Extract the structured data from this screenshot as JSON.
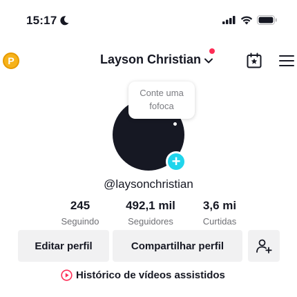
{
  "status_bar": {
    "time": "15:17",
    "icons": [
      "moon-icon",
      "signal-icon",
      "wifi-icon",
      "battery-icon"
    ]
  },
  "topbar": {
    "coin_label": "P",
    "username": "Layson Christian",
    "icons": [
      "chevron-down-icon",
      "calendar-star-icon",
      "menu-icon"
    ],
    "notification_color": "#fe2c55"
  },
  "profile": {
    "bubble_line1": "Conte uma",
    "bubble_line2": "fofoca",
    "add_symbol": "+",
    "handle": "@laysonchristian",
    "accent_color": "#20d5ec"
  },
  "stats": [
    {
      "value": "245",
      "label": "Seguindo"
    },
    {
      "value": "492,1 mil",
      "label": "Seguidores"
    },
    {
      "value": "3,6 mi",
      "label": "Curtidas"
    }
  ],
  "actions": {
    "edit_label": "Editar perfil",
    "share_label": "Compartilhar perfil",
    "add_friend_icon": "add-friend-icon"
  },
  "history": {
    "label": "Histórico de vídeos assistidos",
    "icon": "play-circle-icon",
    "icon_color": "#fe2c55"
  }
}
